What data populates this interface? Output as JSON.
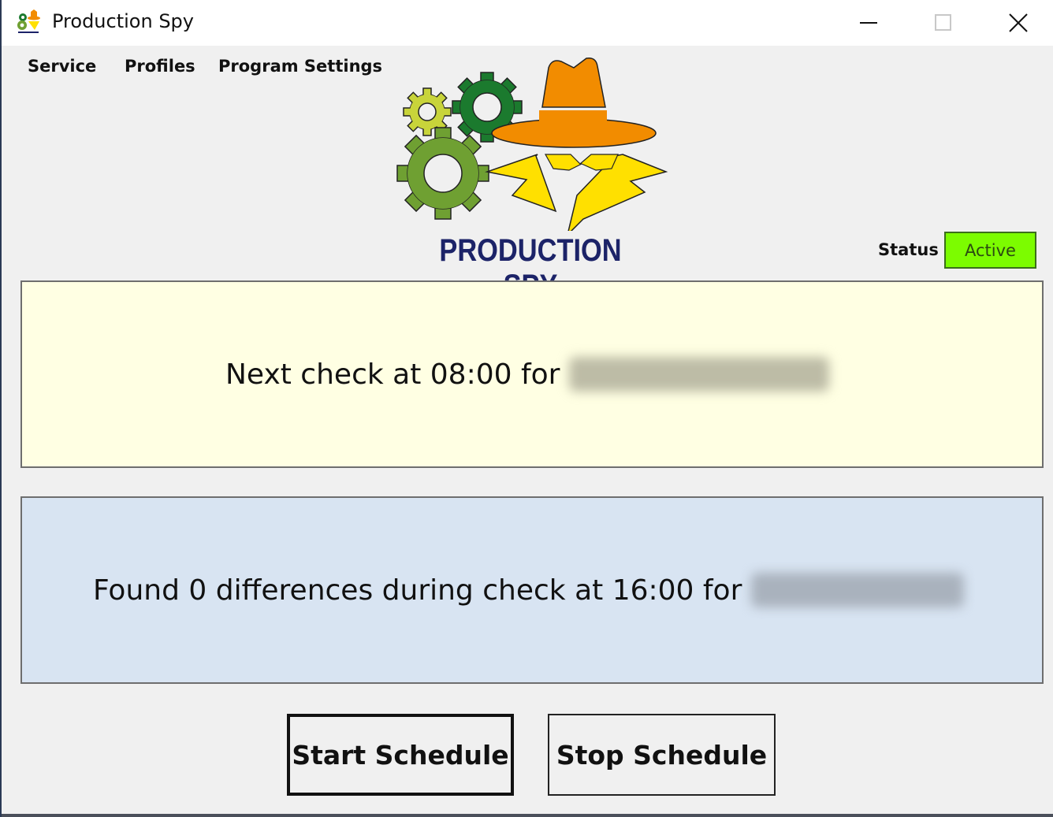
{
  "window": {
    "title": "Production Spy",
    "controls": {
      "minimize": "minimize-icon",
      "maximize": "maximize-icon",
      "close": "close-icon"
    }
  },
  "menu": {
    "items": [
      {
        "label": "Service"
      },
      {
        "label": "Profiles"
      },
      {
        "label": "Program Settings"
      }
    ]
  },
  "logo": {
    "title": "PRODUCTION SPY",
    "colors": {
      "hat": "#f28c00",
      "coat": "#ffe000",
      "gear_small": "#c8d43a",
      "gear_dark": "#1b7a2e",
      "gear_large": "#6fa032",
      "text": "#1c2368"
    }
  },
  "status": {
    "label": "Status",
    "value": "Active",
    "color": "#7cfc00"
  },
  "panels": {
    "next_check": {
      "text": "Next check at 08:00 for",
      "name_redacted": true
    },
    "found": {
      "text": "Found 0 differences during check at 16:00 for",
      "name_redacted": true
    }
  },
  "buttons": {
    "start": "Start Schedule",
    "stop": "Stop Schedule"
  }
}
